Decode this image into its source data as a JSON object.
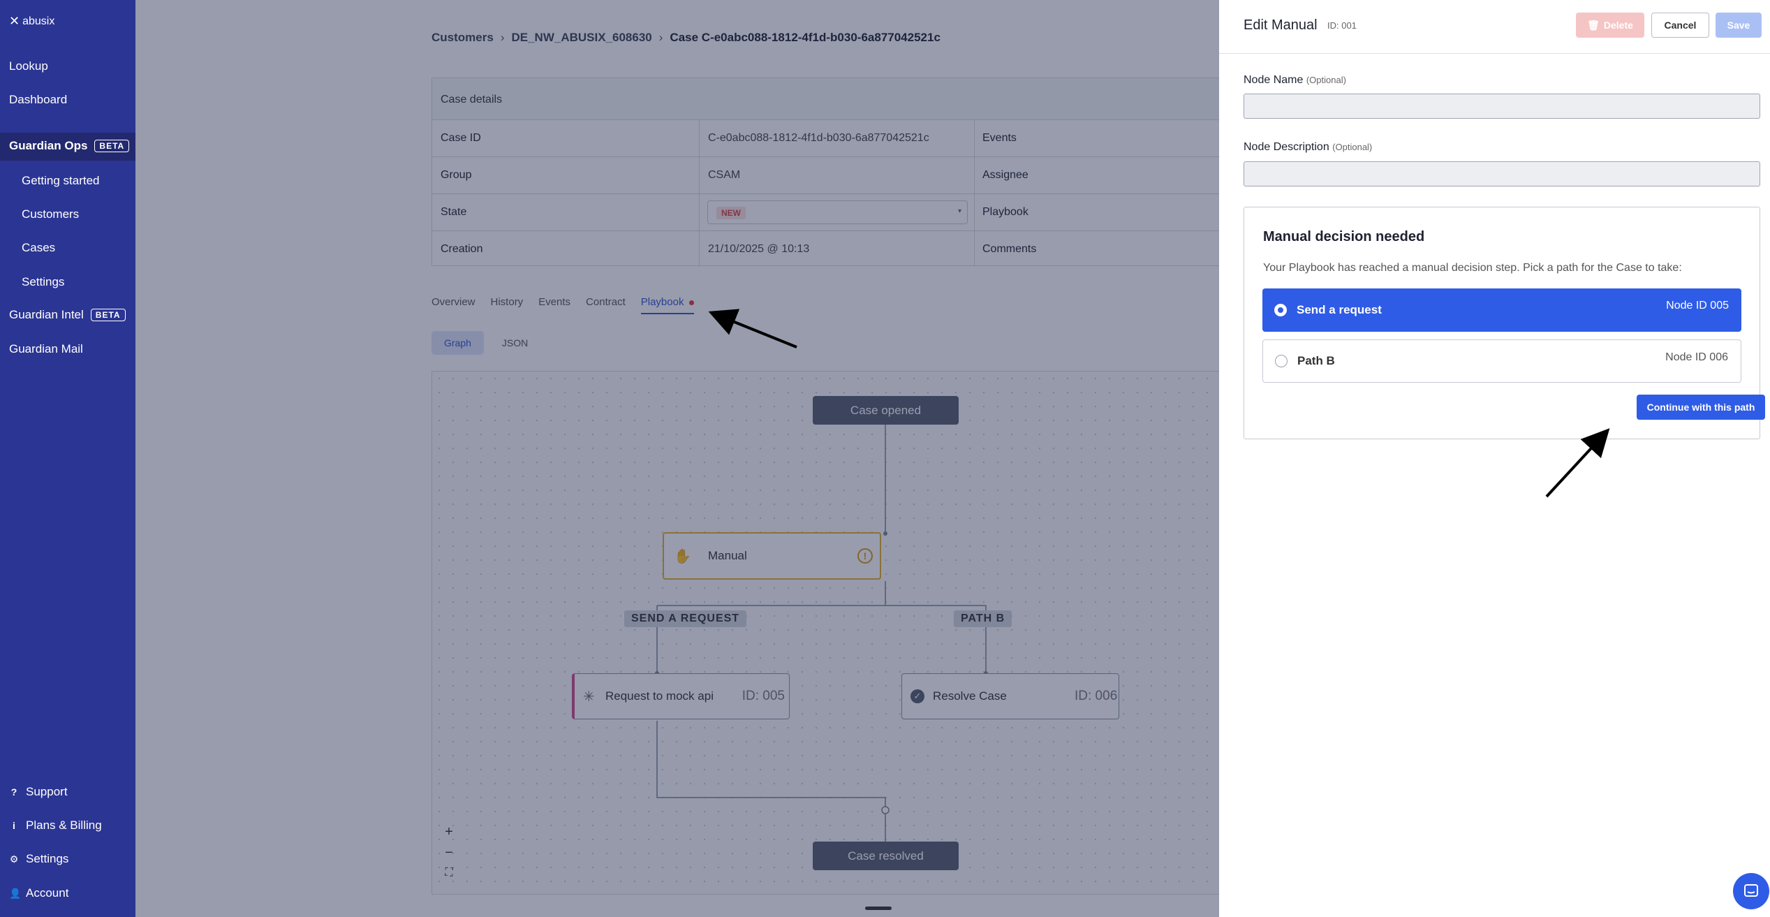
{
  "colors": {
    "sidebar_bg": "#2b3593",
    "accent": "#2f5ce6",
    "manual_border": "#e3b22a",
    "new_badge": "#d24545",
    "overlay": "rgba(30,40,75,0.46)"
  },
  "sidebar": {
    "logo": "abusix",
    "items": [
      {
        "label": "Lookup"
      },
      {
        "label": "Dashboard"
      },
      {
        "label": "Guardian Ops",
        "badge": "BETA"
      },
      {
        "label": "Getting started"
      },
      {
        "label": "Customers"
      },
      {
        "label": "Cases"
      },
      {
        "label": "Settings"
      },
      {
        "label": "Guardian Intel",
        "badge": "BETA"
      },
      {
        "label": "Guardian Mail"
      }
    ],
    "footer": [
      {
        "label": "Support",
        "icon": "question-icon"
      },
      {
        "label": "Plans & Billing",
        "icon": "info-icon"
      },
      {
        "label": "Settings",
        "icon": "gear-icon"
      },
      {
        "label": "Account",
        "icon": "user-icon"
      }
    ]
  },
  "breadcrumb": {
    "items": [
      "Customers",
      "DE_NW_ABUSIX_608630",
      "Case C-e0abc088-1812-4f1d-b030-6a877042521c"
    ]
  },
  "case_details": {
    "title": "Case details",
    "rows": [
      {
        "label": "Case ID",
        "value": "C-e0abc088-1812-4f1d-b030-6a877042521c",
        "right": "Events"
      },
      {
        "label": "Group",
        "value": "CSAM",
        "right": "Assignee"
      },
      {
        "label": "State",
        "value": "NEW",
        "right": "Playbook"
      },
      {
        "label": "Creation",
        "value": "21/10/2025 @ 10:13",
        "right": "Comments"
      }
    ]
  },
  "tabs": [
    "Overview",
    "History",
    "Events",
    "Contract",
    "Playbook"
  ],
  "active_tab": "Playbook",
  "subtabs": [
    "Graph",
    "JSON"
  ],
  "graph": {
    "start": "Case opened",
    "manual": "Manual",
    "branch_a": "SEND A REQUEST",
    "branch_b": "PATH B",
    "node_a": {
      "label": "Request to mock api",
      "id": "ID: 005"
    },
    "node_b": {
      "label": "Resolve Case",
      "id": "ID: 006"
    },
    "end": "Case resolved",
    "zoom": [
      "+",
      "−",
      "⛶"
    ]
  },
  "panel": {
    "title": "Edit Manual",
    "id": "ID: 001",
    "delete_label": "Delete",
    "cancel_label": "Cancel",
    "save_label": "Save",
    "node_name_label": "Node Name",
    "node_desc_label": "Node Description",
    "optional": "(Optional)",
    "node_name_value": "",
    "node_desc_value": "",
    "decision": {
      "title": "Manual decision needed",
      "description": "Your Playbook has reached a manual decision step. Pick a path for the Case to take:",
      "options": [
        {
          "label": "Send a request",
          "node": "Node ID 005",
          "selected": true
        },
        {
          "label": "Path B",
          "node": "Node ID 006",
          "selected": false
        }
      ],
      "continue_label": "Continue with this path"
    }
  }
}
